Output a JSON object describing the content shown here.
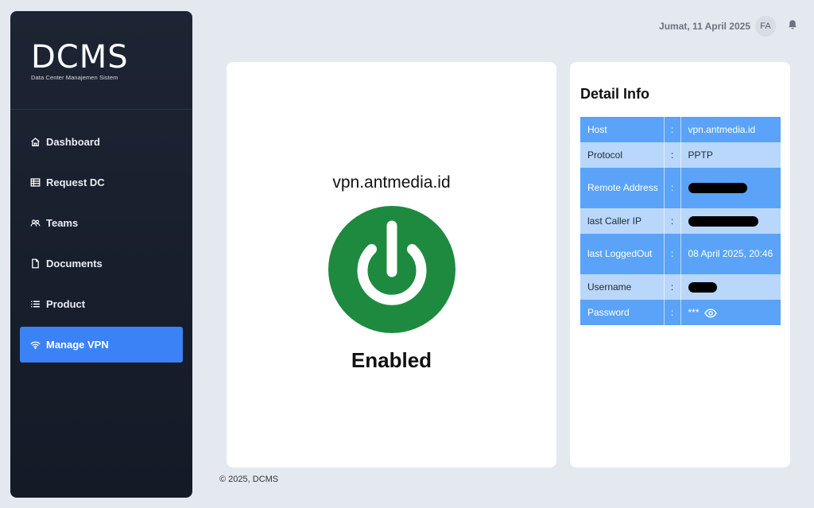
{
  "brand": {
    "title": "DCMS",
    "subtitle": "Data Center Manajemen Sistem"
  },
  "sidebar": {
    "items": [
      {
        "label": "Dashboard",
        "icon": "home-icon",
        "active": false
      },
      {
        "label": "Request DC",
        "icon": "table-icon",
        "active": false
      },
      {
        "label": "Teams",
        "icon": "users-icon",
        "active": false
      },
      {
        "label": "Documents",
        "icon": "document-icon",
        "active": false
      },
      {
        "label": "Product",
        "icon": "list-icon",
        "active": false
      },
      {
        "label": "Manage VPN",
        "icon": "wifi-icon",
        "active": true
      }
    ]
  },
  "header": {
    "date": "Jumat, 11 April 2025",
    "avatar_initials": "FA"
  },
  "vpn": {
    "host": "vpn.antmedia.id",
    "status": "Enabled",
    "status_color": "#1e8a3f"
  },
  "detail": {
    "title": "Detail Info",
    "separator": ":",
    "rows": [
      {
        "key": "Host",
        "value": "vpn.antmedia.id"
      },
      {
        "key": "Protocol",
        "value": "PPTP"
      },
      {
        "key": "Remote Address",
        "value": ""
      },
      {
        "key": "last Caller IP",
        "value": ""
      },
      {
        "key": "last LoggedOut",
        "value": "08 April 2025, 20:46"
      },
      {
        "key": "Username",
        "value": ""
      },
      {
        "key": "Password",
        "value": "***"
      }
    ]
  },
  "footer": {
    "text": "© 2025, DCMS"
  },
  "colors": {
    "accent": "#3b82f6",
    "row_dark": "#5aa3f8",
    "row_light": "#b8d7fb"
  }
}
